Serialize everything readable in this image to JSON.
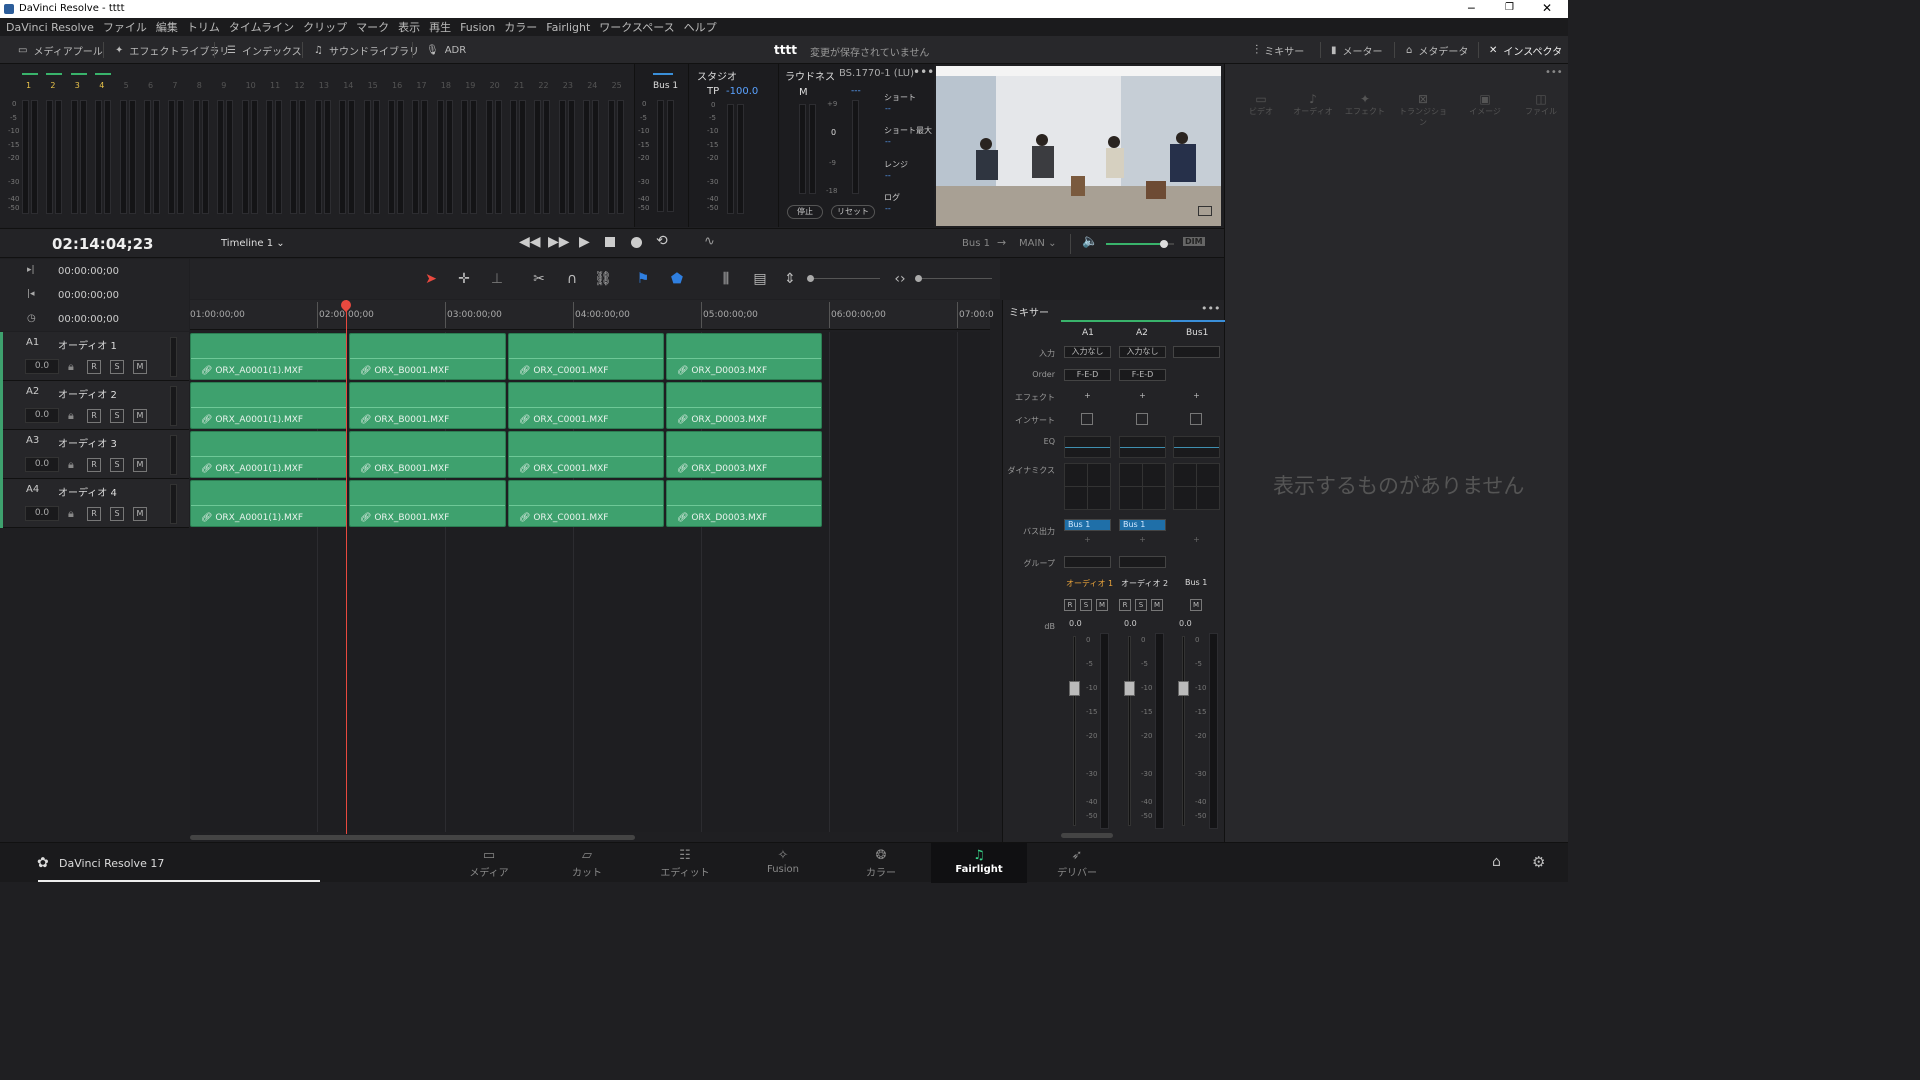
{
  "window": {
    "title": "DaVinci Resolve - tttt",
    "min": "─",
    "max": "❐",
    "close": "✕"
  },
  "menu": [
    "DaVinci Resolve",
    "ファイル",
    "編集",
    "トリム",
    "タイムライン",
    "クリップ",
    "マーク",
    "表示",
    "再生",
    "Fusion",
    "カラー",
    "Fairlight",
    "ワークスペース",
    "ヘルプ"
  ],
  "toolbar": {
    "media_pool": "メディアプール",
    "effects_library": "エフェクトライブラリ",
    "index": "インデックス",
    "sound_library": "サウンドライブラリ",
    "adr": "ADR",
    "project": "tttt",
    "save_status": "変更が保存されていません",
    "mixer": "ミキサー",
    "meter": "メーター",
    "metadata": "メタデータ",
    "inspector": "インスペクタ"
  },
  "meters": {
    "channels": [
      "1",
      "2",
      "3",
      "4",
      "5",
      "6",
      "7",
      "8",
      "9",
      "10",
      "11",
      "12",
      "13",
      "14",
      "15",
      "16",
      "17",
      "18",
      "19",
      "20",
      "21",
      "22",
      "23",
      "24",
      "25"
    ],
    "scale": [
      "0",
      "-5",
      "-10",
      "-15",
      "-20",
      "-30",
      "-40",
      "-50"
    ]
  },
  "bus_meter": {
    "label": "Bus 1",
    "scale": [
      "0",
      "-5",
      "-10",
      "-15",
      "-20",
      "-30",
      "-40",
      "-50"
    ]
  },
  "studio": {
    "title": "スタジオ",
    "tp_label": "TP",
    "tp_value": "-100.0",
    "scale": [
      "0",
      "-5",
      "-10",
      "-15",
      "-20",
      "-30",
      "-40",
      "-50"
    ]
  },
  "loudness": {
    "title": "ラウドネス",
    "standard": "BS.1770-1 (LU)",
    "m_label": "M",
    "m_value": "---",
    "scale": [
      "+9",
      "0",
      "-9",
      "-18"
    ],
    "stop": "停止",
    "reset": "リセット",
    "stats": [
      {
        "label": "ショート",
        "value": "--"
      },
      {
        "label": "ショート最大",
        "value": "--"
      },
      {
        "label": "レンジ",
        "value": "--"
      },
      {
        "label": "ログ",
        "value": "--"
      }
    ]
  },
  "inspector": {
    "tabs": [
      "ビデオ",
      "オーディオ",
      "エフェクト",
      "トランジション",
      "イメージ",
      "ファイル"
    ],
    "empty": "表示するものがありません"
  },
  "transport": {
    "timecode": "02:14:04;23",
    "timeline": "Timeline 1",
    "bus": "Bus 1",
    "main": "MAIN",
    "dim": "DIM",
    "volume": 0.85
  },
  "tc_rows": [
    "00:00:00;00",
    "00:00:00;00",
    "00:00:00;00"
  ],
  "ruler": [
    "01:00:00;00",
    "02:00:00;00",
    "03:00:00;00",
    "04:00:00;00",
    "05:00:00;00",
    "06:00:00;00",
    "07:00:0"
  ],
  "tracks": [
    {
      "id": "A1",
      "name": "オーディオ 1",
      "vol": "0.0"
    },
    {
      "id": "A2",
      "name": "オーディオ 2",
      "vol": "0.0"
    },
    {
      "id": "A3",
      "name": "オーディオ 3",
      "vol": "0.0"
    },
    {
      "id": "A4",
      "name": "オーディオ 4",
      "vol": "0.0"
    }
  ],
  "track_buttons": [
    "R",
    "S",
    "M"
  ],
  "clips": [
    "ORX_A0001(1).MXF",
    "ORX_B0001.MXF",
    "ORX_C0001.MXF",
    "ORX_D0003.MXF"
  ],
  "mixer": {
    "title": "ミキサー",
    "columns": [
      "A1",
      "A2",
      "Bus1"
    ],
    "row_labels": {
      "input": "入力",
      "order": "Order",
      "effects": "エフェクト",
      "insert": "インサート",
      "eq": "EQ",
      "dynamics": "ダイナミクス",
      "bus_out": "バス出力",
      "group": "グループ",
      "db": "dB"
    },
    "input": [
      "入力なし",
      "入力なし",
      ""
    ],
    "order": [
      "F-E-D",
      "F-E-D",
      ""
    ],
    "plus": "+",
    "bus_out": [
      "Bus 1",
      "Bus 1",
      ""
    ],
    "channel_names": [
      "オーディオ 1",
      "オーディオ 2",
      "Bus 1"
    ],
    "rsm": [
      "R",
      "S",
      "M"
    ],
    "m_only": "M",
    "gains": [
      "0.0",
      "0.0",
      "0.0"
    ],
    "fader_scale": [
      "0",
      "-5",
      "-10",
      "-15",
      "-20",
      "-30",
      "-40",
      "-50"
    ]
  },
  "bottom": {
    "app": "DaVinci Resolve 17",
    "pages": [
      "メディア",
      "カット",
      "エディット",
      "Fusion",
      "カラー",
      "Fairlight",
      "デリバー"
    ],
    "active": "Fairlight"
  }
}
